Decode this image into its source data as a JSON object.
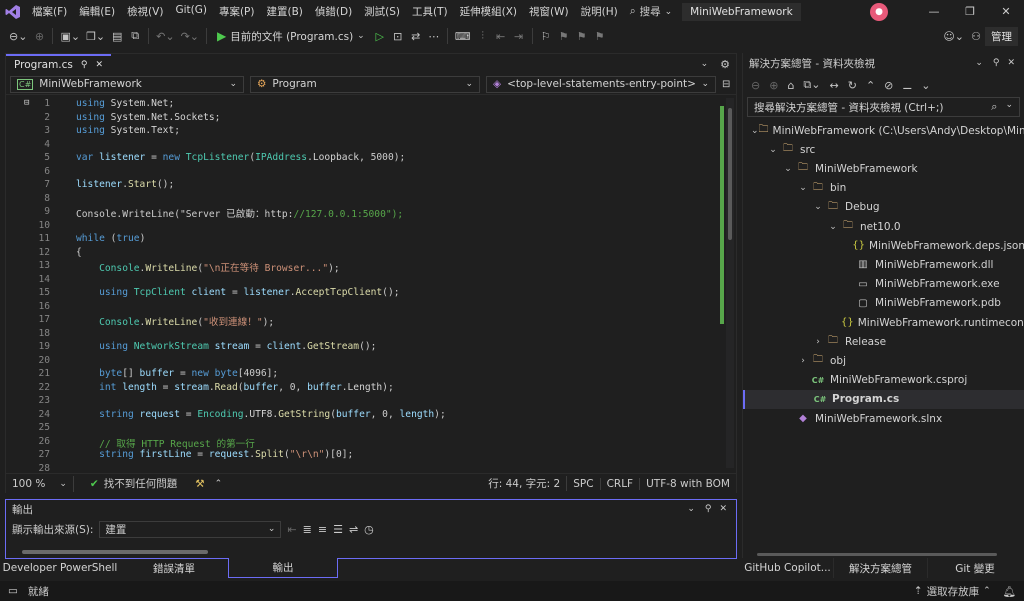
{
  "menu": {
    "items": [
      "檔案(F)",
      "編輯(E)",
      "檢視(V)",
      "Git(G)",
      "專案(P)",
      "建置(B)",
      "偵錯(D)",
      "測試(S)",
      "工具(T)",
      "延伸模組(X)",
      "視窗(W)",
      "說明(H)"
    ],
    "search_label": "搜尋",
    "solution_name": "MiniWebFramework"
  },
  "toolbar": {
    "run_target": "目前的文件 (Program.cs)",
    "manage_label": "管理"
  },
  "editor": {
    "tab_label": "Program.cs",
    "project_dropdown": "MiniWebFramework",
    "class_dropdown": "Program",
    "member_dropdown": "<top-level-statements-entry-point>",
    "lines": [
      {
        "n": "1",
        "t": "using System.Net;"
      },
      {
        "n": "2",
        "t": "using System.Net.Sockets;"
      },
      {
        "n": "3",
        "t": "using System.Text;"
      },
      {
        "n": "4",
        "t": ""
      },
      {
        "n": "5",
        "t": "var listener = new TcpListener(IPAddress.Loopback, 5000);"
      },
      {
        "n": "6",
        "t": ""
      },
      {
        "n": "7",
        "t": "listener.Start();"
      },
      {
        "n": "8",
        "t": ""
      },
      {
        "n": "9",
        "t": "Console.WriteLine(\"Server 已啟動：http://127.0.0.1:5000\");"
      },
      {
        "n": "10",
        "t": ""
      },
      {
        "n": "11",
        "t": "while (true)"
      },
      {
        "n": "12",
        "t": "{"
      },
      {
        "n": "13",
        "t": "    Console.WriteLine(\"\\n正在等待 Browser...\");"
      },
      {
        "n": "14",
        "t": ""
      },
      {
        "n": "15",
        "t": "    using TcpClient client = listener.AcceptTcpClient();"
      },
      {
        "n": "16",
        "t": ""
      },
      {
        "n": "17",
        "t": "    Console.WriteLine(\"收到連線！\");"
      },
      {
        "n": "18",
        "t": ""
      },
      {
        "n": "19",
        "t": "    using NetworkStream stream = client.GetStream();"
      },
      {
        "n": "20",
        "t": ""
      },
      {
        "n": "21",
        "t": "    byte[] buffer = new byte[4096];"
      },
      {
        "n": "22",
        "t": "    int length = stream.Read(buffer, 0, buffer.Length);"
      },
      {
        "n": "23",
        "t": ""
      },
      {
        "n": "24",
        "t": "    string request = Encoding.UTF8.GetString(buffer, 0, length);"
      },
      {
        "n": "25",
        "t": ""
      },
      {
        "n": "26",
        "t": "    // 取得 HTTP Request 的第一行"
      },
      {
        "n": "27",
        "t": "    string firstLine = request.Split(\"\\r\\n\")[0];"
      },
      {
        "n": "28",
        "t": ""
      }
    ],
    "zoom": "100 %",
    "issues": "找不到任何問題",
    "position": "行: 44, 字元: 2",
    "whitespace": "SPC",
    "line_ending": "CRLF",
    "encoding": "UTF-8 with BOM"
  },
  "output": {
    "title": "輸出",
    "source_label": "顯示輸出來源(S):",
    "source_value": "建置"
  },
  "bottom_tabs": [
    "Developer PowerShell",
    "錯誤清單",
    "輸出"
  ],
  "solution_explorer": {
    "title": "解決方案總管 - 資料夾檢視",
    "search_placeholder": "搜尋解決方案總管 - 資料夾檢視 (Ctrl+;)",
    "items": [
      {
        "label": "MiniWebFramework (C:\\Users\\Andy\\Desktop\\MiniWebFramework)",
        "icon": "folder-icon",
        "chev": "⌄",
        "indent": 0
      },
      {
        "label": "src",
        "icon": "folder-icon",
        "chev": "⌄",
        "indent": 1
      },
      {
        "label": "MiniWebFramework",
        "icon": "folder-icon",
        "chev": "⌄",
        "indent": 2
      },
      {
        "label": "bin",
        "icon": "folder-icon",
        "chev": "⌄",
        "indent": 3
      },
      {
        "label": "Debug",
        "icon": "folder-icon",
        "chev": "⌄",
        "indent": 4
      },
      {
        "label": "net10.0",
        "icon": "folder-icon",
        "chev": "⌄",
        "indent": 5
      },
      {
        "label": "MiniWebFramework.deps.json",
        "icon": "json-file-icon",
        "chev": "",
        "indent": 6
      },
      {
        "label": "MiniWebFramework.dll",
        "icon": "dll-file-icon",
        "chev": "",
        "indent": 6
      },
      {
        "label": "MiniWebFramework.exe",
        "icon": "exe-file-icon",
        "chev": "",
        "indent": 6
      },
      {
        "label": "MiniWebFramework.pdb",
        "icon": "pdb-file-icon",
        "chev": "",
        "indent": 6
      },
      {
        "label": "MiniWebFramework.runtimeconfig.json",
        "icon": "json-file-icon",
        "chev": "",
        "indent": 6
      },
      {
        "label": "Release",
        "icon": "folder-icon",
        "chev": "›",
        "indent": 4
      },
      {
        "label": "obj",
        "icon": "folder-icon",
        "chev": "›",
        "indent": 3
      },
      {
        "label": "MiniWebFramework.csproj",
        "icon": "csproj-file-icon",
        "chev": "",
        "indent": 3
      },
      {
        "label": "Program.cs",
        "icon": "csharp-file-icon",
        "chev": "",
        "indent": 3
      },
      {
        "label": "MiniWebFramework.slnx",
        "icon": "solution-file-icon",
        "chev": "",
        "indent": 2
      }
    ],
    "tabs": [
      "GitHub Copilot...",
      "解決方案總管",
      "Git 變更"
    ]
  },
  "statusbar": {
    "ready": "就緒",
    "repo": "選取存放庫"
  },
  "colors": {
    "accent": "#6c6cf5",
    "play": "#4ec94e",
    "keyword": "#569cd6",
    "type": "#4ec9b0",
    "string": "#ce9178",
    "comment": "#57a64a"
  }
}
